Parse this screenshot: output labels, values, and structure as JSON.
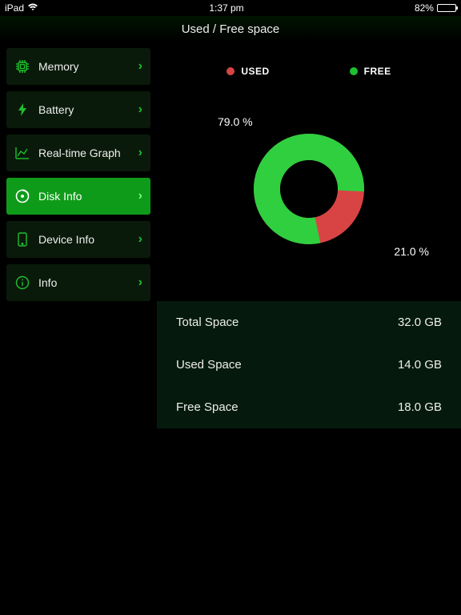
{
  "status": {
    "device": "iPad",
    "time": "1:37 pm",
    "battery_pct": "82%"
  },
  "header": {
    "title": "Used / Free space"
  },
  "sidebar": {
    "items": [
      {
        "label": "Memory",
        "icon": "cpu",
        "active": false
      },
      {
        "label": "Battery",
        "icon": "bolt",
        "active": false
      },
      {
        "label": "Real-time Graph",
        "icon": "graph",
        "active": false
      },
      {
        "label": "Disk Info",
        "icon": "disk",
        "active": true
      },
      {
        "label": "Device Info",
        "icon": "device",
        "active": false
      },
      {
        "label": "Info",
        "icon": "info",
        "active": false
      }
    ]
  },
  "legend": {
    "used": "USED",
    "free": "FREE"
  },
  "percentages": {
    "free": "79.0 %",
    "used": "21.0 %"
  },
  "info": {
    "total_label": "Total Space",
    "total_value": "32.0 GB",
    "used_label": "Used Space",
    "used_value": "14.0 GB",
    "free_label": "Free Space",
    "free_value": "18.0 GB"
  },
  "colors": {
    "used": "#d84444",
    "free": "#1fbf2f"
  },
  "chart_data": {
    "type": "pie",
    "title": "Used / Free space",
    "series": [
      {
        "name": "USED",
        "value": 21.0,
        "color": "#d84444"
      },
      {
        "name": "FREE",
        "value": 79.0,
        "color": "#1fbf2f"
      }
    ]
  }
}
